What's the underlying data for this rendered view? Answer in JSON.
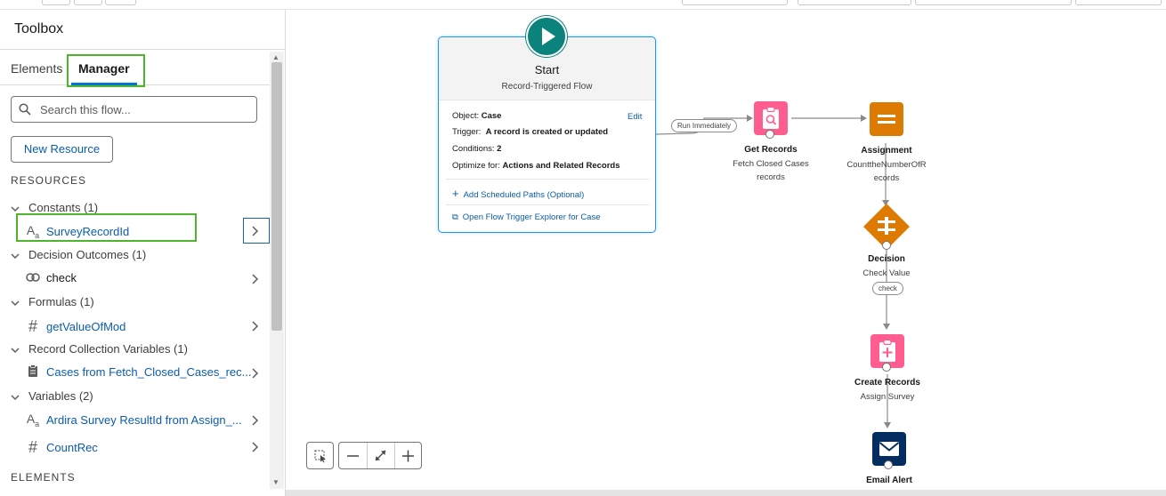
{
  "toolbox": {
    "title": "Toolbox",
    "tabs": [
      {
        "label": "Elements"
      },
      {
        "label": "Manager"
      }
    ],
    "search_placeholder": "Search this flow...",
    "new_resource_label": "New Resource",
    "resources_title": "RESOURCES",
    "elements_title": "ELEMENTS",
    "groups": [
      {
        "label": "Constants (1)",
        "items": [
          {
            "label": "SurveyRecordId",
            "icon": "text-icon"
          }
        ]
      },
      {
        "label": "Decision Outcomes (1)",
        "items": [
          {
            "label": "check",
            "icon": "outcome-icon"
          }
        ]
      },
      {
        "label": "Formulas (1)",
        "items": [
          {
            "label": "getValueOfMod",
            "icon": "number-icon"
          }
        ]
      },
      {
        "label": "Record Collection Variables (1)",
        "items": [
          {
            "label": "Cases from Fetch_Closed_Cases_rec...",
            "icon": "clipboard-icon"
          }
        ]
      },
      {
        "label": "Variables (2)",
        "items": [
          {
            "label": "Ardira Survey ResultId from Assign_...",
            "icon": "text-icon"
          },
          {
            "label": "CountRec",
            "icon": "number-icon"
          }
        ]
      }
    ]
  },
  "start": {
    "title": "Start",
    "subtitle": "Record-Triggered Flow",
    "object_label": "Object:",
    "object_value": "Case",
    "edit_label": "Edit",
    "trigger_label": "Trigger:",
    "trigger_value": "A record is created or updated",
    "conditions_label": "Conditions:",
    "conditions_value": "2",
    "optimize_label": "Optimize for:",
    "optimize_value": "Actions and Related Records",
    "add_paths_label": "Add Scheduled Paths (Optional)",
    "explorer_label": "Open Flow Trigger Explorer for Case"
  },
  "connectors": {
    "run_immediately": "Run Immediately",
    "check": "check"
  },
  "nodes": {
    "get_records": {
      "title": "Get Records",
      "sub1": "Fetch Closed Cases",
      "sub2": "records",
      "color": "#ff5d8f"
    },
    "assignment": {
      "title": "Assignment",
      "sub1": "CounttheNumberOfR",
      "sub2": "ecords",
      "color": "#dd7a01"
    },
    "decision": {
      "title": "Decision",
      "sub1": "Check Value",
      "color": "#dd7a01"
    },
    "create_records": {
      "title": "Create Records",
      "sub1": "Assign Survey",
      "color": "#ff5d8f"
    },
    "email_alert": {
      "title": "Email Alert",
      "color": "#032d60"
    }
  },
  "colors": {
    "highlight": "#4db52b",
    "accent": "#0176d3",
    "link": "#0b5cab",
    "start": "#0b827c"
  }
}
